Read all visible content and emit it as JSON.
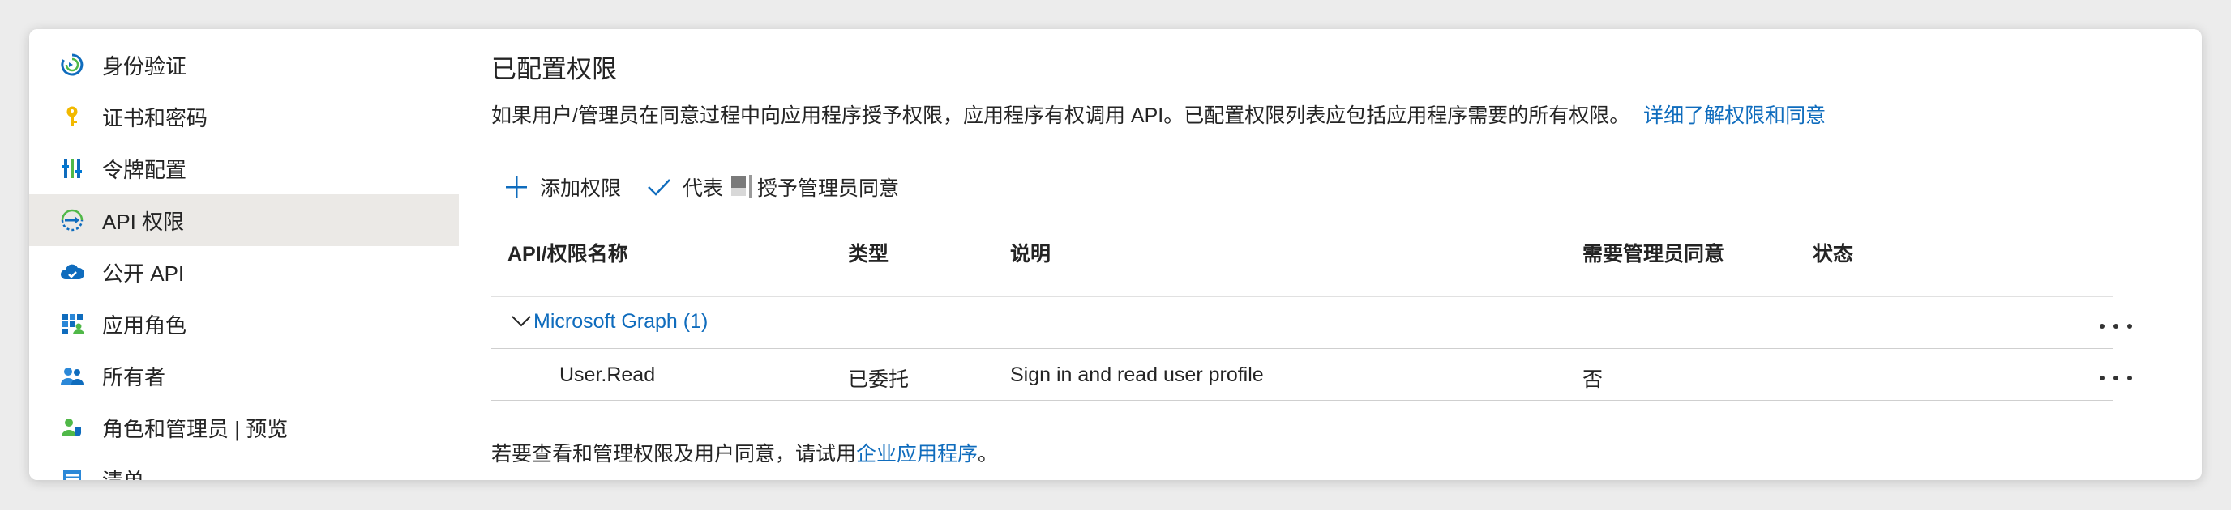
{
  "sidebar": {
    "items": [
      {
        "label": "身份验证",
        "icon": "auth-refresh-icon"
      },
      {
        "label": "证书和密码",
        "icon": "key-icon"
      },
      {
        "label": "令牌配置",
        "icon": "token-bars-icon"
      },
      {
        "label": "API 权限",
        "icon": "api-arrow-icon",
        "active": true
      },
      {
        "label": "公开 API",
        "icon": "cloud-icon"
      },
      {
        "label": "应用角色",
        "icon": "grid-people-icon"
      },
      {
        "label": "所有者",
        "icon": "people-icon"
      },
      {
        "label": "角色和管理员 | 预览",
        "icon": "person-shield-icon"
      },
      {
        "label": "清单",
        "icon": "list-icon"
      }
    ]
  },
  "main": {
    "title": "已配置权限",
    "description": "如果用户/管理员在同意过程中向应用程序授予权限，应用程序有权调用 API。已配置权限列表应包括应用程序需要的所有权限。",
    "description_link": "详细了解权限和同意",
    "toolbar": {
      "add_label": "添加权限",
      "grant_prefix": "代表",
      "grant_suffix": "授予管理员同意"
    },
    "table": {
      "headers": {
        "name": "API/权限名称",
        "type": "类型",
        "description": "说明",
        "admin_consent": "需要管理员同意",
        "status": "状态"
      },
      "group": {
        "label": "Microsoft Graph (1)"
      },
      "rows": [
        {
          "name": "User.Read",
          "type": "已委托",
          "description": "Sign in and read user profile",
          "admin_consent": "否",
          "status": ""
        }
      ]
    },
    "footer": {
      "prefix": "若要查看和管理权限及用户同意，请试用",
      "link": "企业应用程序",
      "suffix": "。"
    }
  },
  "colors": {
    "accent": "#0f6cbd",
    "active_bg": "#ebe9e6"
  }
}
